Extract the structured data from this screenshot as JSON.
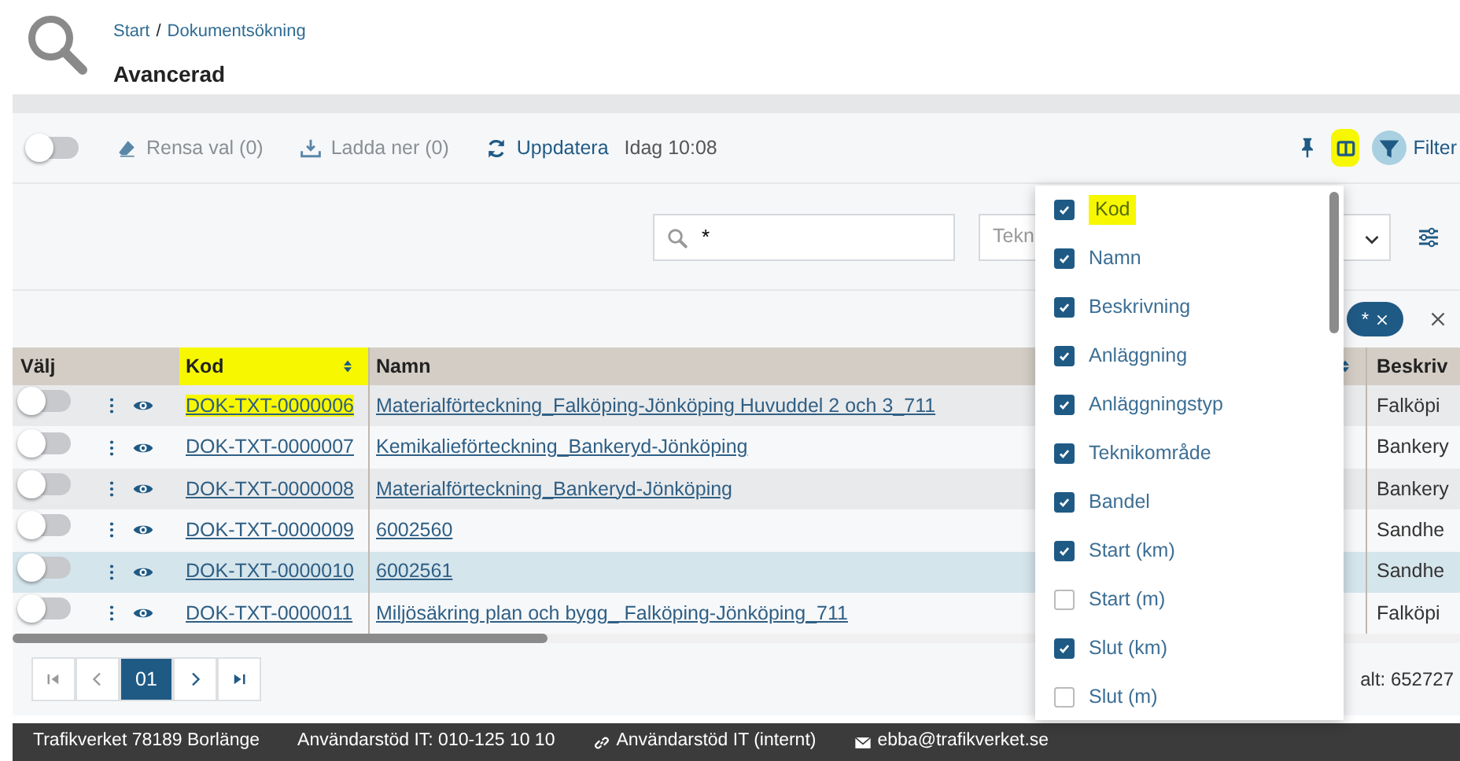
{
  "breadcrumb": [
    {
      "label": "Start",
      "separator": "/"
    },
    {
      "label": "Dokumentsökning"
    }
  ],
  "page_title": "Avancerad",
  "toolbar": {
    "select_all_on": false,
    "clear": "Rensa val (0)",
    "download": "Ladda ner (0)",
    "refresh": "Uppdatera",
    "updated": "Idag 10:08",
    "columns_highlighted": true,
    "filter": "Filter"
  },
  "search": {
    "value": "*",
    "select_text": "Tekn"
  },
  "chips": [
    {
      "label": "*"
    }
  ],
  "table": {
    "columns": [
      {
        "label": "Välj"
      },
      {
        "label": "Kod",
        "highlighted": true
      },
      {
        "label": "Namn"
      },
      {
        "label": "Beskriv"
      }
    ],
    "rows": [
      {
        "on": false,
        "active": false,
        "code": "DOK-TXT-0000006",
        "code_highlighted": true,
        "name": "Materialförteckning_Falköping-Jönköping Huvuddel 2 och 3_711",
        "desc": "Falköpi"
      },
      {
        "on": false,
        "active": false,
        "code": "DOK-TXT-0000007",
        "code_highlighted": false,
        "name": "Kemikalieförteckning_Bankeryd-Jönköping",
        "desc": "Bankery"
      },
      {
        "on": false,
        "active": false,
        "code": "DOK-TXT-0000008",
        "code_highlighted": false,
        "name": "Materialförteckning_Bankeryd-Jönköping",
        "desc": "Bankery"
      },
      {
        "on": false,
        "active": false,
        "code": "DOK-TXT-0000009",
        "code_highlighted": false,
        "name": "6002560",
        "desc": "Sandhe"
      },
      {
        "on": false,
        "active": true,
        "code": "DOK-TXT-0000010",
        "code_highlighted": false,
        "name": "6002561",
        "desc": "Sandhe"
      },
      {
        "on": false,
        "active": false,
        "code": "DOK-TXT-0000011",
        "code_highlighted": false,
        "name": "Miljösäkring plan och bygg_ Falköping-Jönköping_711",
        "desc": "Falköpi"
      }
    ]
  },
  "pagination": {
    "pages": [
      {
        "label": "01",
        "selected": true
      }
    ],
    "total": "alt: 652727"
  },
  "column_menu": [
    {
      "label": "Kod",
      "checked": true,
      "highlighted": true
    },
    {
      "label": "Namn",
      "checked": true,
      "highlighted": false
    },
    {
      "label": "Beskrivning",
      "checked": true,
      "highlighted": false
    },
    {
      "label": "Anläggning",
      "checked": true,
      "highlighted": false
    },
    {
      "label": "Anläggningstyp",
      "checked": true,
      "highlighted": false
    },
    {
      "label": "Teknikområde",
      "checked": true,
      "highlighted": false
    },
    {
      "label": "Bandel",
      "checked": true,
      "highlighted": false
    },
    {
      "label": "Start (km)",
      "checked": true,
      "highlighted": false
    },
    {
      "label": "Start (m)",
      "checked": false,
      "highlighted": false
    },
    {
      "label": "Slut (km)",
      "checked": true,
      "highlighted": false
    },
    {
      "label": "Slut (m)",
      "checked": false,
      "highlighted": false
    }
  ],
  "footer": [
    {
      "kind": "text",
      "label": "Trafikverket 78189 Borlänge"
    },
    {
      "kind": "text",
      "label": "Användarstöd IT: 010-125 10 10"
    },
    {
      "kind": "link",
      "label": "Användarstöd IT (internt)"
    },
    {
      "kind": "mail",
      "label": "ebba@trafikverket.se"
    }
  ]
}
